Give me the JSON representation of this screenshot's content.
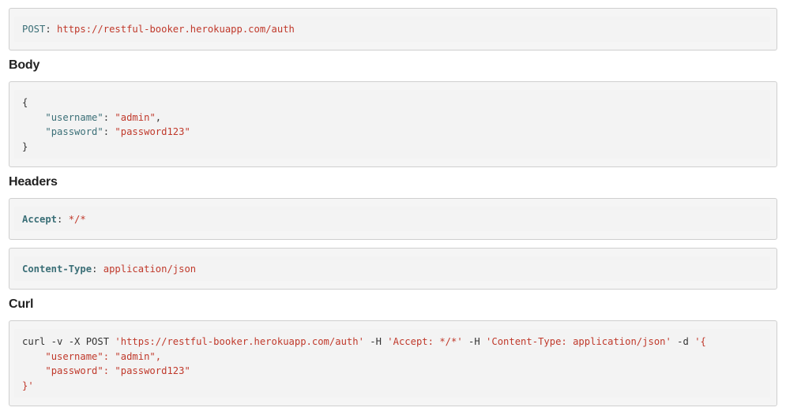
{
  "request": {
    "method": "POST",
    "url": "https://restful-booker.herokuapp.com/auth"
  },
  "headings": {
    "body": "Body",
    "headers": "Headers",
    "curl": "Curl"
  },
  "body": {
    "open": "{",
    "close": "}",
    "username_key": "\"username\"",
    "username_value": "\"admin\"",
    "password_key": "\"password\"",
    "password_value": "\"password123\""
  },
  "headers": [
    {
      "name": "Accept",
      "value": "*/*"
    },
    {
      "name": "Content-Type",
      "value": "application/json"
    }
  ],
  "curl": {
    "cmd": "curl -v -X POST ",
    "url": "'https://restful-booker.herokuapp.com/auth'",
    "h_flag1": " -H ",
    "h_accept": "'Accept: */*'",
    "h_flag2": " -H ",
    "h_ctype": "'Content-Type: application/json'",
    "d_flag": " -d ",
    "d_open": "'{",
    "username_line": "\"username\": \"admin\",",
    "password_line": "\"password\": \"password123\"",
    "d_close": "}'"
  },
  "colors": {
    "keyword": "#3b6f77",
    "string": "#c0392b",
    "block_bg": "#f5f5f5"
  }
}
